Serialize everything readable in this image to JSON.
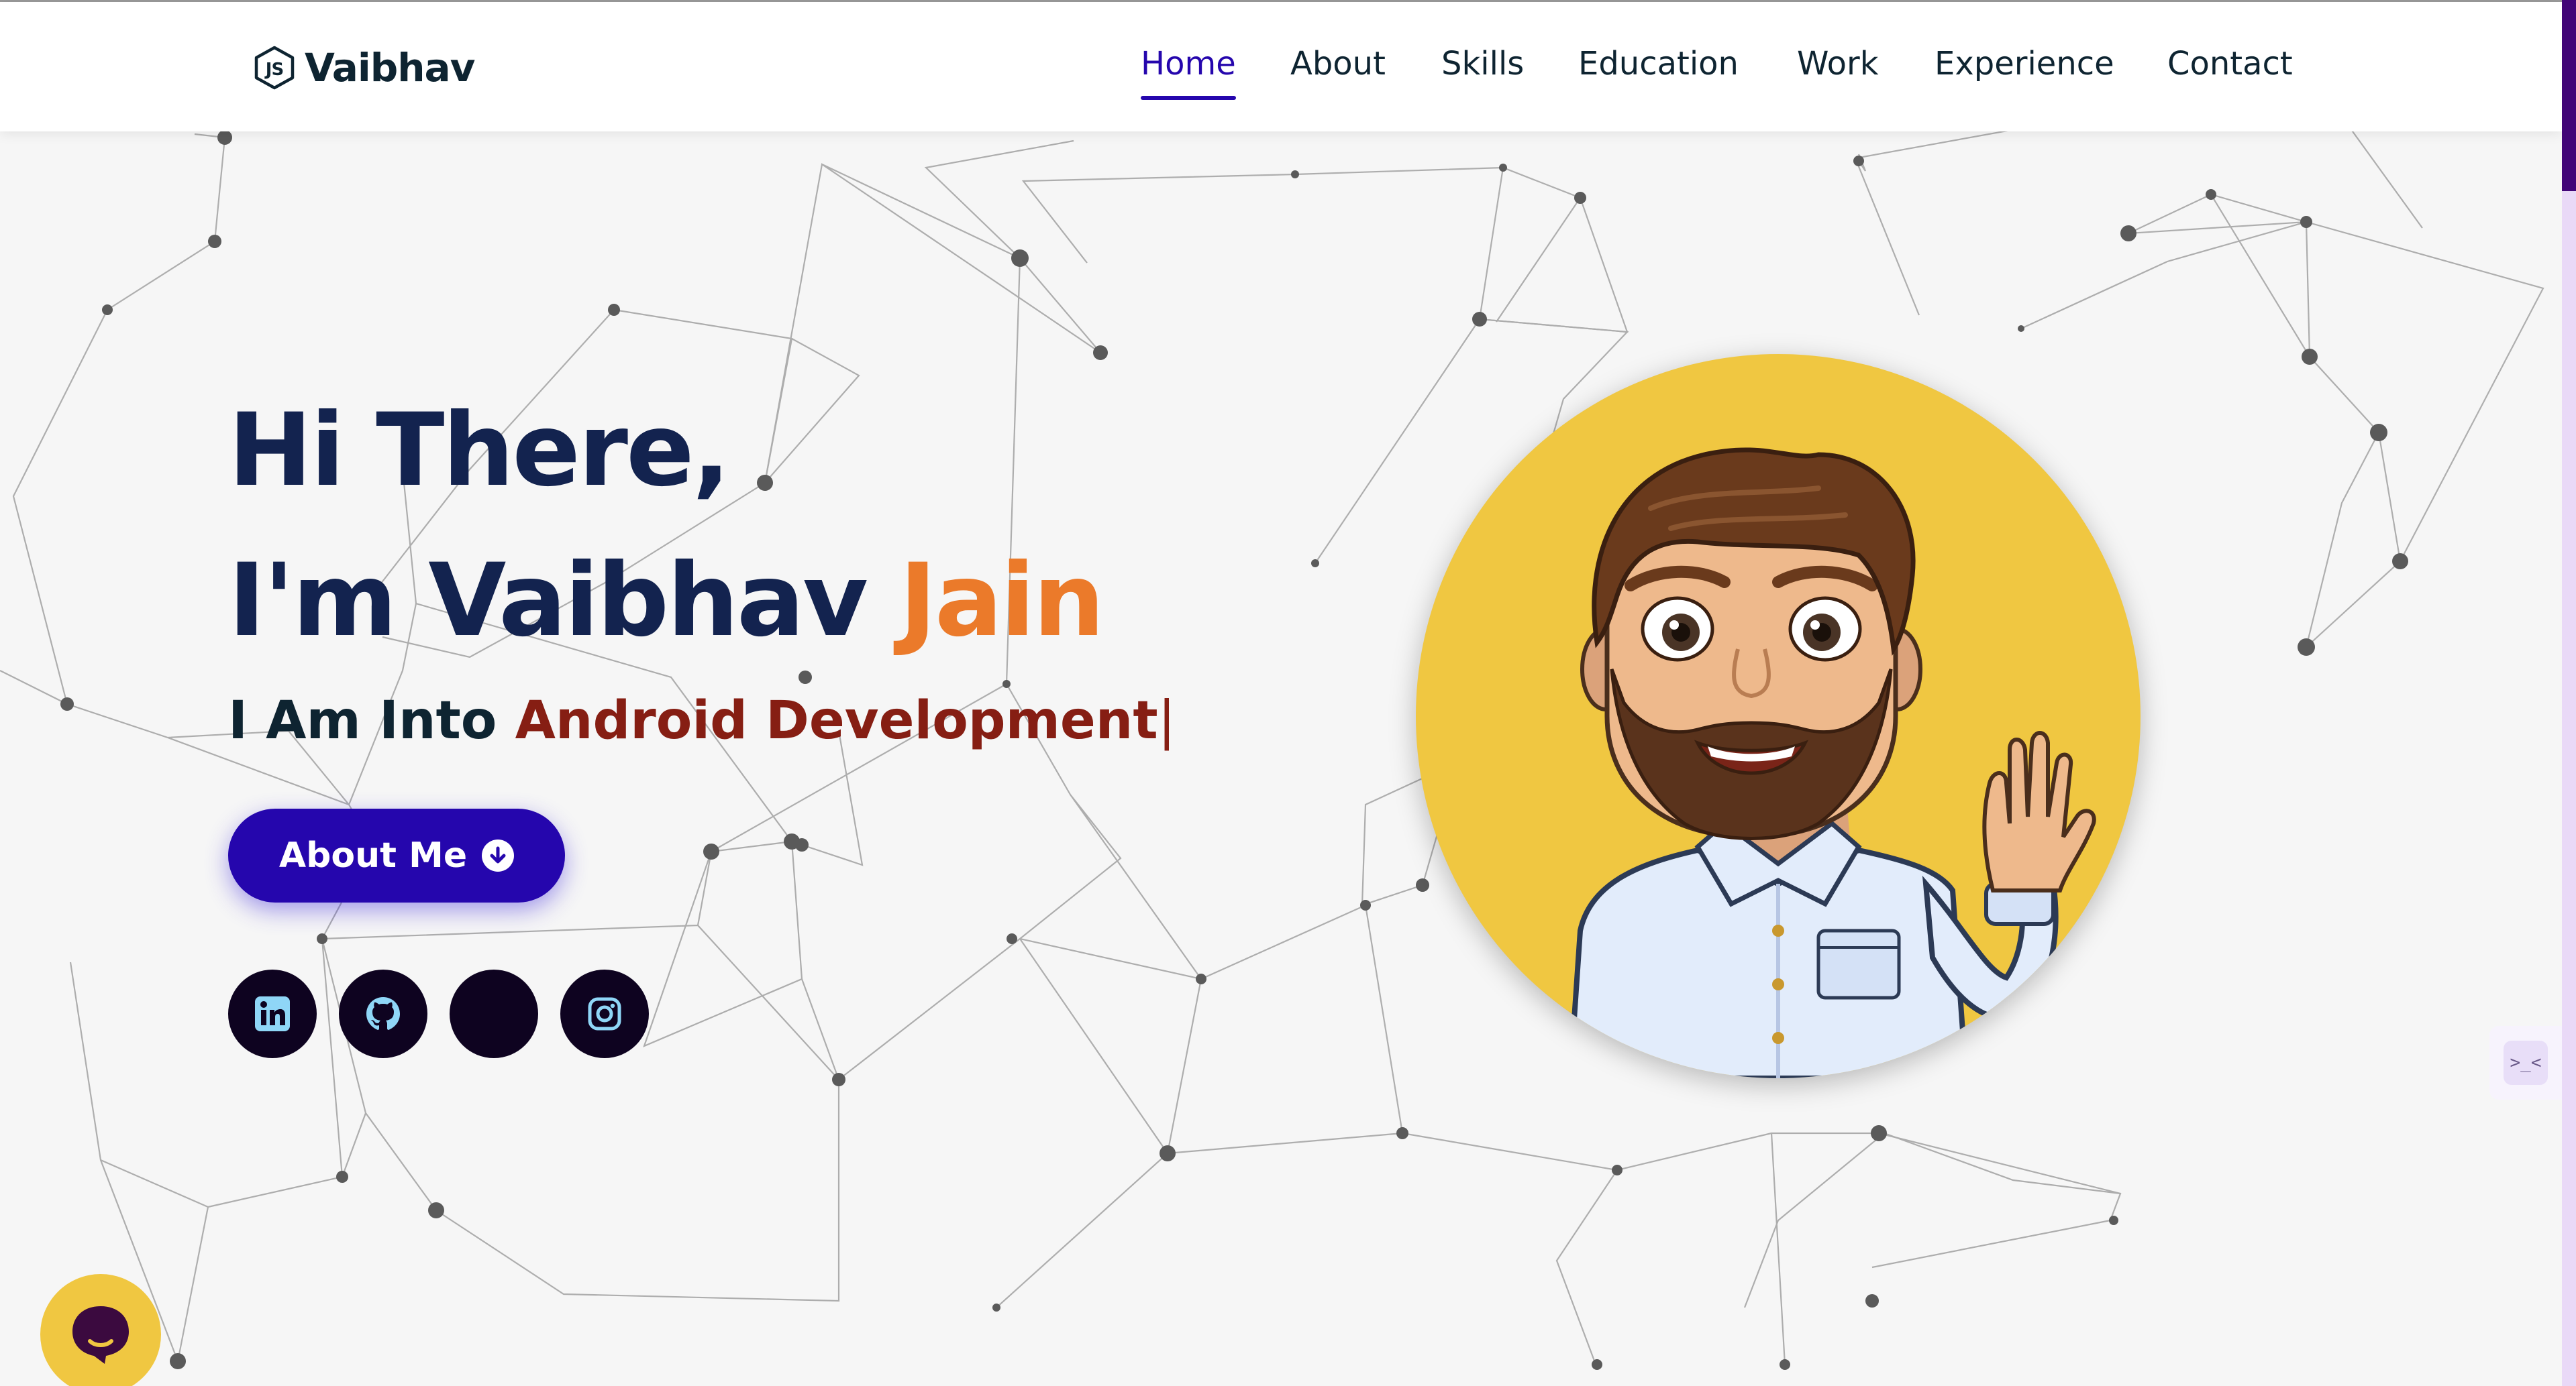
{
  "logo": {
    "text": "Vaibhav",
    "icon": "js-hexagon-icon"
  },
  "nav": {
    "items": [
      {
        "label": "Home",
        "active": true
      },
      {
        "label": "About",
        "active": false
      },
      {
        "label": "Skills",
        "active": false
      },
      {
        "label": "Education",
        "active": false
      },
      {
        "label": "Work",
        "active": false
      },
      {
        "label": "Experience",
        "active": false
      },
      {
        "label": "Contact",
        "active": false
      }
    ]
  },
  "hero": {
    "greeting": "Hi There,",
    "intro_prefix": "I'm Vaibhav ",
    "intro_accent": "Jain",
    "typing_prefix": "I Am Into ",
    "typing_role": "Android Development",
    "typing_caret": "|",
    "about_button": "About Me"
  },
  "socials": [
    {
      "icon": "linkedin-icon"
    },
    {
      "icon": "github-icon"
    },
    {
      "icon": "blank-social-icon"
    },
    {
      "icon": "instagram-icon"
    }
  ],
  "side_tab": {
    "text": ">_<"
  },
  "colors": {
    "accent_blue": "#2506ad",
    "accent_orange": "#eb7a2a",
    "role_red": "#861e13",
    "heading_navy": "#13234f",
    "avatar_bg": "#f0c741",
    "social_bg": "#0e0320"
  }
}
